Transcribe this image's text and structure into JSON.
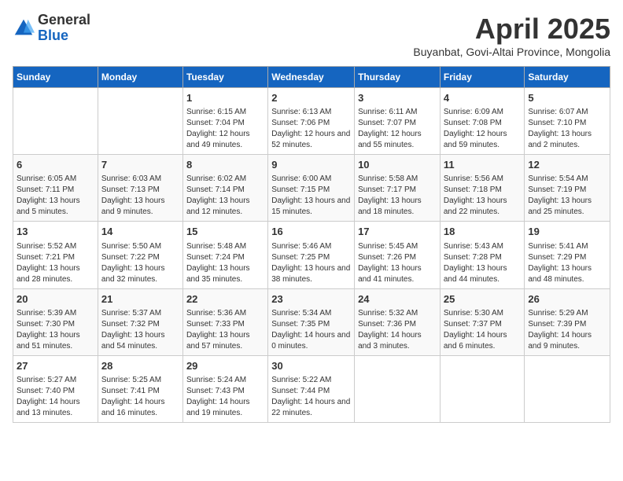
{
  "header": {
    "logo_general": "General",
    "logo_blue": "Blue",
    "month_title": "April 2025",
    "location": "Buyanbat, Govi-Altai Province, Mongolia"
  },
  "weekdays": [
    "Sunday",
    "Monday",
    "Tuesday",
    "Wednesday",
    "Thursday",
    "Friday",
    "Saturday"
  ],
  "weeks": [
    [
      {
        "day": "",
        "info": ""
      },
      {
        "day": "",
        "info": ""
      },
      {
        "day": "1",
        "info": "Sunrise: 6:15 AM\nSunset: 7:04 PM\nDaylight: 12 hours and 49 minutes."
      },
      {
        "day": "2",
        "info": "Sunrise: 6:13 AM\nSunset: 7:06 PM\nDaylight: 12 hours and 52 minutes."
      },
      {
        "day": "3",
        "info": "Sunrise: 6:11 AM\nSunset: 7:07 PM\nDaylight: 12 hours and 55 minutes."
      },
      {
        "day": "4",
        "info": "Sunrise: 6:09 AM\nSunset: 7:08 PM\nDaylight: 12 hours and 59 minutes."
      },
      {
        "day": "5",
        "info": "Sunrise: 6:07 AM\nSunset: 7:10 PM\nDaylight: 13 hours and 2 minutes."
      }
    ],
    [
      {
        "day": "6",
        "info": "Sunrise: 6:05 AM\nSunset: 7:11 PM\nDaylight: 13 hours and 5 minutes."
      },
      {
        "day": "7",
        "info": "Sunrise: 6:03 AM\nSunset: 7:13 PM\nDaylight: 13 hours and 9 minutes."
      },
      {
        "day": "8",
        "info": "Sunrise: 6:02 AM\nSunset: 7:14 PM\nDaylight: 13 hours and 12 minutes."
      },
      {
        "day": "9",
        "info": "Sunrise: 6:00 AM\nSunset: 7:15 PM\nDaylight: 13 hours and 15 minutes."
      },
      {
        "day": "10",
        "info": "Sunrise: 5:58 AM\nSunset: 7:17 PM\nDaylight: 13 hours and 18 minutes."
      },
      {
        "day": "11",
        "info": "Sunrise: 5:56 AM\nSunset: 7:18 PM\nDaylight: 13 hours and 22 minutes."
      },
      {
        "day": "12",
        "info": "Sunrise: 5:54 AM\nSunset: 7:19 PM\nDaylight: 13 hours and 25 minutes."
      }
    ],
    [
      {
        "day": "13",
        "info": "Sunrise: 5:52 AM\nSunset: 7:21 PM\nDaylight: 13 hours and 28 minutes."
      },
      {
        "day": "14",
        "info": "Sunrise: 5:50 AM\nSunset: 7:22 PM\nDaylight: 13 hours and 32 minutes."
      },
      {
        "day": "15",
        "info": "Sunrise: 5:48 AM\nSunset: 7:24 PM\nDaylight: 13 hours and 35 minutes."
      },
      {
        "day": "16",
        "info": "Sunrise: 5:46 AM\nSunset: 7:25 PM\nDaylight: 13 hours and 38 minutes."
      },
      {
        "day": "17",
        "info": "Sunrise: 5:45 AM\nSunset: 7:26 PM\nDaylight: 13 hours and 41 minutes."
      },
      {
        "day": "18",
        "info": "Sunrise: 5:43 AM\nSunset: 7:28 PM\nDaylight: 13 hours and 44 minutes."
      },
      {
        "day": "19",
        "info": "Sunrise: 5:41 AM\nSunset: 7:29 PM\nDaylight: 13 hours and 48 minutes."
      }
    ],
    [
      {
        "day": "20",
        "info": "Sunrise: 5:39 AM\nSunset: 7:30 PM\nDaylight: 13 hours and 51 minutes."
      },
      {
        "day": "21",
        "info": "Sunrise: 5:37 AM\nSunset: 7:32 PM\nDaylight: 13 hours and 54 minutes."
      },
      {
        "day": "22",
        "info": "Sunrise: 5:36 AM\nSunset: 7:33 PM\nDaylight: 13 hours and 57 minutes."
      },
      {
        "day": "23",
        "info": "Sunrise: 5:34 AM\nSunset: 7:35 PM\nDaylight: 14 hours and 0 minutes."
      },
      {
        "day": "24",
        "info": "Sunrise: 5:32 AM\nSunset: 7:36 PM\nDaylight: 14 hours and 3 minutes."
      },
      {
        "day": "25",
        "info": "Sunrise: 5:30 AM\nSunset: 7:37 PM\nDaylight: 14 hours and 6 minutes."
      },
      {
        "day": "26",
        "info": "Sunrise: 5:29 AM\nSunset: 7:39 PM\nDaylight: 14 hours and 9 minutes."
      }
    ],
    [
      {
        "day": "27",
        "info": "Sunrise: 5:27 AM\nSunset: 7:40 PM\nDaylight: 14 hours and 13 minutes."
      },
      {
        "day": "28",
        "info": "Sunrise: 5:25 AM\nSunset: 7:41 PM\nDaylight: 14 hours and 16 minutes."
      },
      {
        "day": "29",
        "info": "Sunrise: 5:24 AM\nSunset: 7:43 PM\nDaylight: 14 hours and 19 minutes."
      },
      {
        "day": "30",
        "info": "Sunrise: 5:22 AM\nSunset: 7:44 PM\nDaylight: 14 hours and 22 minutes."
      },
      {
        "day": "",
        "info": ""
      },
      {
        "day": "",
        "info": ""
      },
      {
        "day": "",
        "info": ""
      }
    ]
  ]
}
